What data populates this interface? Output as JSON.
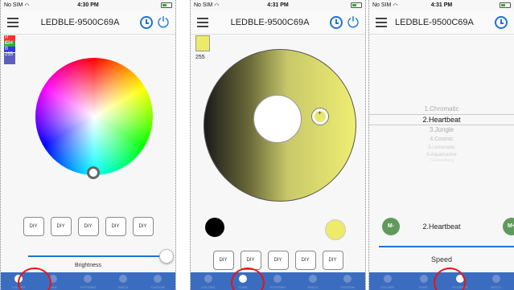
{
  "status": {
    "carrier": "No SIM",
    "wifi_icon": "wifi-icon",
    "time1": "4:30 PM",
    "time2": "4:31 PM",
    "time3": "4:31 PM"
  },
  "app_title": "LEDBLE-9500C69A",
  "screen1": {
    "rgb": {
      "r_label": "R 134",
      "g_label": "G",
      "b_label": "B 255"
    },
    "diy_buttons": [
      "DIY",
      "DIY",
      "DIY",
      "DIY",
      "DIY"
    ],
    "brightness_label": "Brightness",
    "brightness_level": 0.95
  },
  "screen2": {
    "chip_value": "255",
    "diy_buttons": [
      "DIY",
      "DIY",
      "DIY",
      "DIY",
      "DIY"
    ]
  },
  "screen3": {
    "modes": [
      "1.Chromatic",
      "2.Heartbeat",
      "3.Jungle",
      "4.Cosmic",
      "5.Lemonade",
      "6.Aquamarine",
      "7.Gooseberry"
    ],
    "selected_mode": "2.Heartbeat",
    "minus_label": "M-",
    "plus_label": "M+",
    "speed_label": "Speed",
    "speed_level": 0.95
  },
  "tabs": [
    "COLORS",
    "FUNC",
    "SYSTEMS",
    "DISCO",
    "CUSTOM"
  ],
  "colors": {
    "accent": "#1e73d6",
    "tabbar": "#3a6dbf",
    "highlight": "#e11111",
    "yellow": "#eeea6a",
    "green": "#5f9a5a"
  }
}
